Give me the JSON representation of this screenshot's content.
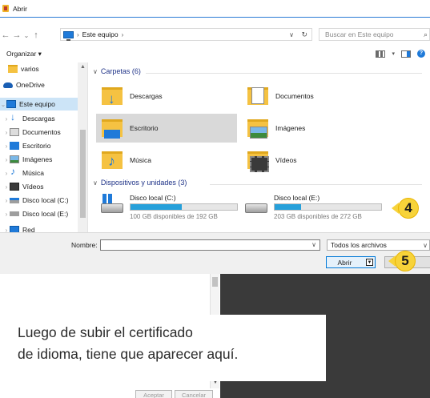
{
  "window": {
    "title": "Abrir"
  },
  "address": {
    "path": [
      "Este equipo"
    ],
    "search_placeholder": "Buscar en Este equipo"
  },
  "toolbar": {
    "organize_label": "Organizar ▾"
  },
  "nav": {
    "items": [
      {
        "label": "varios",
        "icon": "folder-icon"
      },
      {
        "label": "OneDrive",
        "icon": "onedrive-icon"
      },
      {
        "label": "Este equipo",
        "icon": "computer-icon",
        "selected": true
      },
      {
        "label": "Descargas",
        "icon": "downloads-icon"
      },
      {
        "label": "Documentos",
        "icon": "documents-icon"
      },
      {
        "label": "Escritorio",
        "icon": "desktop-icon"
      },
      {
        "label": "Imágenes",
        "icon": "pictures-icon"
      },
      {
        "label": "Música",
        "icon": "music-icon"
      },
      {
        "label": "Vídeos",
        "icon": "videos-icon"
      },
      {
        "label": "Disco local (C:)",
        "icon": "drive-icon"
      },
      {
        "label": "Disco local (E:)",
        "icon": "drive-icon"
      },
      {
        "label": "Red",
        "icon": "network-icon"
      }
    ]
  },
  "content": {
    "folders_header": "Carpetas (6)",
    "folders": [
      {
        "label": "Descargas",
        "icon": "downloads-folder-icon"
      },
      {
        "label": "Documentos",
        "icon": "documents-folder-icon"
      },
      {
        "label": "Escritorio",
        "icon": "desktop-folder-icon",
        "selected": true
      },
      {
        "label": "Imágenes",
        "icon": "pictures-folder-icon"
      },
      {
        "label": "Música",
        "icon": "music-folder-icon"
      },
      {
        "label": "Vídeos",
        "icon": "videos-folder-icon"
      }
    ],
    "drives_header": "Dispositivos y unidades (3)",
    "drives": [
      {
        "label": "Disco local (C:)",
        "free": "100 GB disponibles de 192 GB",
        "used_fraction": 0.48
      },
      {
        "label": "Disco local (E:)",
        "free": "203 GB disponibles de 272 GB",
        "used_fraction": 0.25
      }
    ]
  },
  "bottom": {
    "filename_label": "Nombre:",
    "filename_value": "",
    "filter_value": "Todos los archivos",
    "open_label": "Abrir"
  },
  "callouts": {
    "drives": "4",
    "open": "5"
  },
  "background_dialog": {
    "accept_label": "Aceptar",
    "cancel_label": "Cancelar"
  },
  "note": {
    "line1": "Luego de subir el certificado",
    "line2": "de idioma, tiene que aparecer aquí."
  },
  "colors": {
    "accent": "#1f7ad9",
    "callout": "#f7d33a",
    "selection": "#cce4f7"
  }
}
